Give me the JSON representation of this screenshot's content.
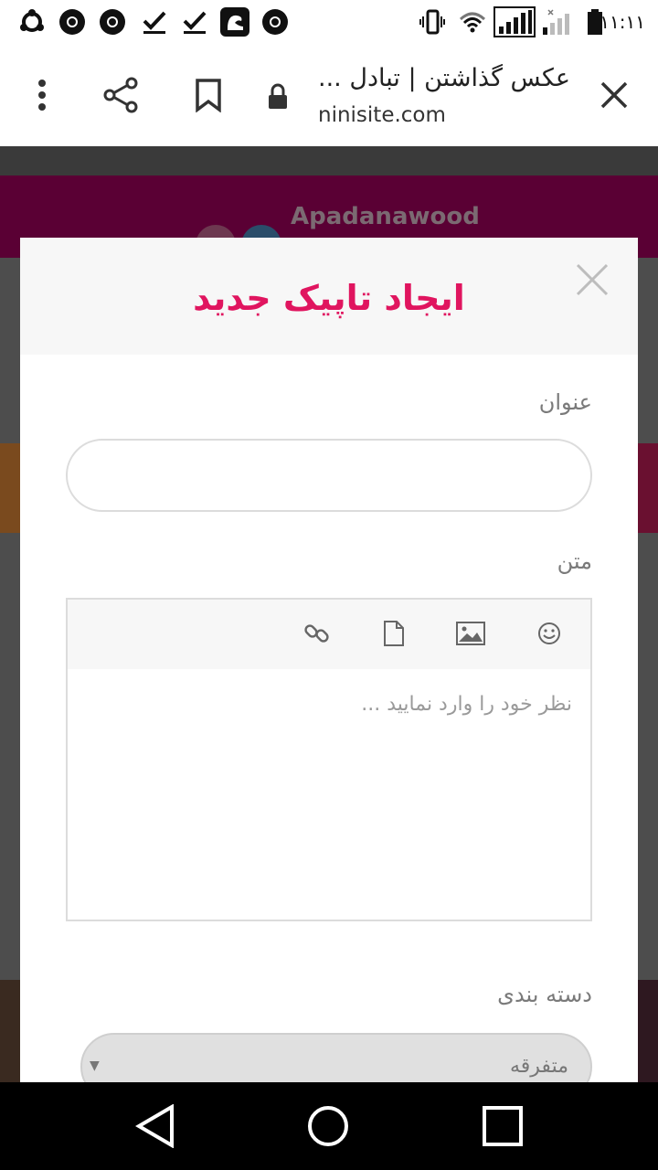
{
  "status_bar": {
    "time": "۱۱:۱۱",
    "left_icons": [
      "sync-icon",
      "chrome-icon",
      "chrome-icon",
      "download-done-icon",
      "download-done-icon",
      "app-icon",
      "chrome-icon"
    ],
    "right_icons": [
      "vibrate-icon",
      "wifi-icon",
      "signal-icon",
      "signal-2-icon",
      "battery-icon"
    ]
  },
  "browser": {
    "page_title": "عکس گذاشتن | تبادل ...",
    "url": "ninisite.com",
    "icons": [
      "menu-dots-icon",
      "share-icon",
      "bookmark-icon",
      "lock-icon",
      "close-icon"
    ]
  },
  "background_page": {
    "banner_text": "Apadanawood"
  },
  "modal": {
    "title": "ایجاد تاپیک جدید",
    "title_label": "عنوان",
    "title_value": "",
    "body_label": "متن",
    "editor_placeholder": "نظر خود را وارد نمایید ...",
    "editor_tools": [
      "emoji-icon",
      "image-icon",
      "file-icon",
      "link-icon"
    ],
    "category_label": "دسته بندی",
    "category_value": "متفرقه"
  },
  "colors": {
    "accent": "#e0155f",
    "backdrop": "#4d4d4d",
    "banner": "#5a0034"
  },
  "navigation": [
    "back-icon",
    "home-icon",
    "recents-icon"
  ]
}
